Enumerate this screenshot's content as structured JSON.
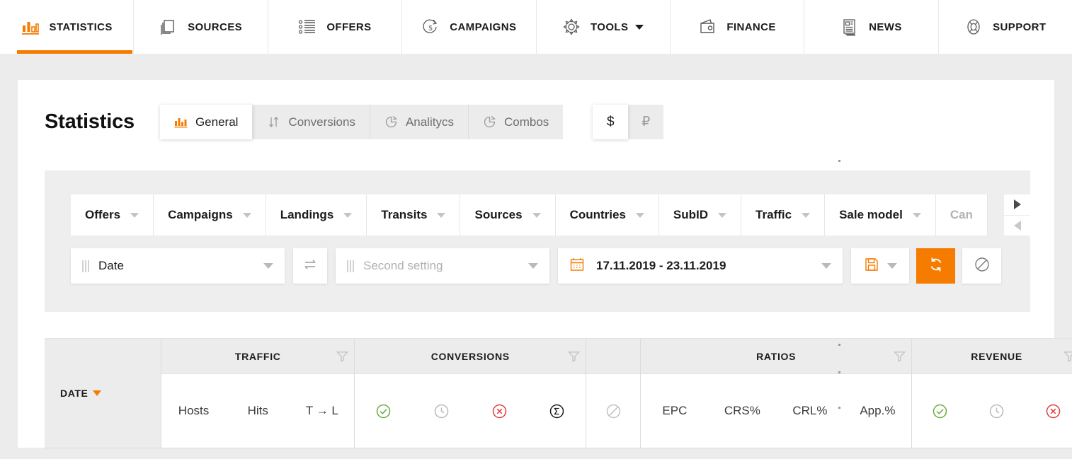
{
  "nav": {
    "items": [
      {
        "label": "STATISTICS",
        "icon": "bar-chart-icon",
        "active": true,
        "caret": false
      },
      {
        "label": "SOURCES",
        "icon": "copy-pages-icon",
        "active": false,
        "caret": false
      },
      {
        "label": "OFFERS",
        "icon": "list-icon",
        "active": false,
        "caret": false
      },
      {
        "label": "CAMPAIGNS",
        "icon": "dollar-cycle-icon",
        "active": false,
        "caret": false
      },
      {
        "label": "TOOLS",
        "icon": "gear-icon",
        "active": false,
        "caret": true
      },
      {
        "label": "FINANCE",
        "icon": "wallet-icon",
        "active": false,
        "caret": false
      },
      {
        "label": "NEWS",
        "icon": "newspaper-icon",
        "active": false,
        "caret": false
      },
      {
        "label": "SUPPORT",
        "icon": "lifebuoy-icon",
        "active": false,
        "caret": false
      }
    ]
  },
  "header": {
    "title": "Statistics",
    "tabs": [
      {
        "label": "General",
        "icon": "bar-chart-icon",
        "active": true
      },
      {
        "label": "Conversions",
        "icon": "sort-arrows-icon",
        "active": false
      },
      {
        "label": "Analitycs",
        "icon": "pie-chart-icon",
        "active": false
      },
      {
        "label": "Combos",
        "icon": "pie-chart-icon",
        "active": false
      }
    ],
    "currency": [
      {
        "label": "$",
        "name": "usd",
        "active": true
      },
      {
        "label": "₽",
        "name": "rub",
        "active": false
      }
    ]
  },
  "filters": {
    "chips": [
      {
        "label": "Offers",
        "faded": false
      },
      {
        "label": "Campaigns",
        "faded": false
      },
      {
        "label": "Landings",
        "faded": false
      },
      {
        "label": "Transits",
        "faded": false
      },
      {
        "label": "Sources",
        "faded": false
      },
      {
        "label": "Countries",
        "faded": false
      },
      {
        "label": "SubID",
        "faded": false
      },
      {
        "label": "Traffic",
        "faded": false
      },
      {
        "label": "Sale model",
        "faded": false
      },
      {
        "label": "Can",
        "faded": true
      }
    ],
    "scroll": {
      "right_icon": "arrow-right-icon",
      "left_icon": "arrow-left-icon"
    },
    "grouping": {
      "first_value": "Date",
      "second_placeholder": "Second setting",
      "swap_icon": "swap-arrows-icon"
    },
    "date_range": {
      "value": "17.11.2019 - 23.11.2019",
      "icon": "calendar-icon"
    },
    "actions": {
      "save_icon": "floppy-save-icon",
      "refresh_icon": "refresh-icon",
      "cancel_icon": "no-entry-icon"
    }
  },
  "table": {
    "date_column": {
      "label": "DATE",
      "sorted": "desc"
    },
    "groups": [
      {
        "title": "TRAFFIC",
        "filter_icon": "funnel-icon",
        "columns": [
          {
            "label": "Hosts",
            "type": "text"
          },
          {
            "label": "Hits",
            "type": "text"
          },
          {
            "label": "T → L",
            "type": "text"
          }
        ]
      },
      {
        "title": "CONVERSIONS",
        "filter_icon": "funnel-icon",
        "columns": [
          {
            "label": "",
            "type": "icon",
            "icon": "check-circle-icon",
            "color": "#6aab3e"
          },
          {
            "label": "",
            "type": "icon",
            "icon": "clock-circle-icon",
            "color": "#b9b9b9"
          },
          {
            "label": "",
            "type": "icon",
            "icon": "x-circle-icon",
            "color": "#e23b3b"
          },
          {
            "label": "",
            "type": "icon",
            "icon": "sigma-circle-icon",
            "color": "#1c1c1c"
          }
        ]
      },
      {
        "title": "",
        "filter_icon": "",
        "columns": [
          {
            "label": "",
            "type": "icon",
            "icon": "no-entry-circle-icon",
            "color": "#c2c2c2"
          }
        ]
      },
      {
        "title": "RATIOS",
        "filter_icon": "funnel-icon",
        "columns": [
          {
            "label": "EPC",
            "type": "text"
          },
          {
            "label": "CRS%",
            "type": "text"
          },
          {
            "label": "CRL%",
            "type": "text"
          },
          {
            "label": "App.%",
            "type": "text"
          }
        ]
      },
      {
        "title": "REVENUE",
        "filter_icon": "funnel-icon",
        "columns": [
          {
            "label": "",
            "type": "icon",
            "icon": "check-circle-icon",
            "color": "#6aab3e"
          },
          {
            "label": "",
            "type": "icon",
            "icon": "clock-circle-icon",
            "color": "#b9b9b9"
          },
          {
            "label": "",
            "type": "icon",
            "icon": "x-circle-icon",
            "color": "#e23b3b"
          }
        ]
      }
    ]
  },
  "colors": {
    "accent": "#f57c00",
    "page_bg": "#ececec",
    "card_bg": "#ffffff",
    "panel_bg": "#eeeeee",
    "success": "#6aab3e",
    "danger": "#e23b3b",
    "muted": "#b9b9b9"
  }
}
